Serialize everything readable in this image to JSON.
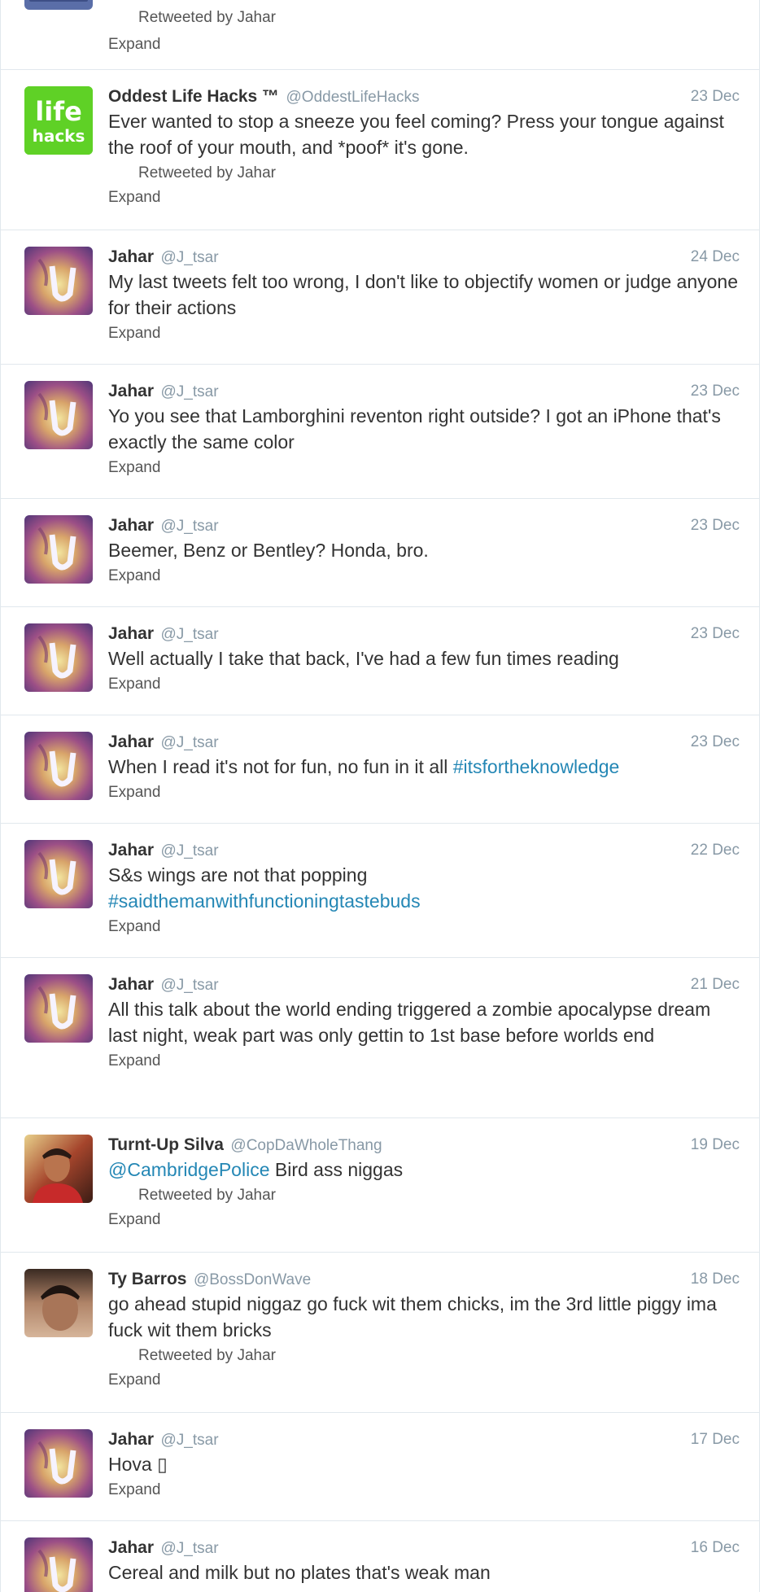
{
  "colors": {
    "link": "#2487b5",
    "meta": "#8899a6",
    "border": "#e1e8ed"
  },
  "top_partial": {
    "retweeted_by": "Retweeted by Jahar",
    "expand": "Expand"
  },
  "tweets": [
    {
      "avatar": "lifehacks-logo",
      "name": "Oddest Life Hacks ™",
      "handle": "@OddestLifeHacks",
      "date": "23 Dec",
      "text": "Ever wanted to stop a sneeze you feel coming? Press your tongue against the roof of your mouth, and *poof* it's gone.",
      "retweeted_by": "Retweeted by Jahar",
      "expand": "Expand"
    },
    {
      "avatar": "jahar-avatar",
      "name": "Jahar",
      "handle": "@J_tsar",
      "date": "24 Dec",
      "text": "My last tweets felt too wrong, I don't like to objectify women or judge anyone  for their actions",
      "expand": "Expand"
    },
    {
      "avatar": "jahar-avatar",
      "name": "Jahar",
      "handle": "@J_tsar",
      "date": "23 Dec",
      "text": "Yo you see that Lamborghini reventon right outside? I got an iPhone that's exactly the same color",
      "expand": "Expand"
    },
    {
      "avatar": "jahar-avatar",
      "name": "Jahar",
      "handle": "@J_tsar",
      "date": "23 Dec",
      "text": "Beemer, Benz or Bentley? Honda, bro.",
      "expand": "Expand"
    },
    {
      "avatar": "jahar-avatar",
      "name": "Jahar",
      "handle": "@J_tsar",
      "date": "23 Dec",
      "text": "Well actually I take that back, I've had a few fun times reading",
      "expand": "Expand"
    },
    {
      "avatar": "jahar-avatar",
      "name": "Jahar",
      "handle": "@J_tsar",
      "date": "23 Dec",
      "text": "When I read it's not for fun, no fun in it all ",
      "hashtag": "#itsfortheknowledge",
      "expand": "Expand"
    },
    {
      "avatar": "jahar-avatar",
      "name": "Jahar",
      "handle": "@J_tsar",
      "date": "22 Dec",
      "text": "S&s wings are not that popping",
      "hashtag_line": "#saidthemanwithfunctioningtastebuds",
      "expand": "Expand"
    },
    {
      "avatar": "jahar-avatar",
      "name": "Jahar",
      "handle": "@J_tsar",
      "date": "21 Dec",
      "text": "All this talk about the world ending triggered a zombie apocalypse dream last night, weak part was only gettin to 1st base before worlds end",
      "expand": "Expand"
    },
    {
      "avatar": "silva-avatar",
      "name": "Turnt-Up Silva",
      "handle": "@CopDaWholeThang",
      "date": "19 Dec",
      "mention": "@CambridgePolice",
      "text": " Bird ass niggas",
      "retweeted_by": "Retweeted by Jahar",
      "expand": "Expand"
    },
    {
      "avatar": "barros-avatar",
      "name": "Ty Barros",
      "handle": "@BossDonWave",
      "date": "18 Dec",
      "text": "go ahead stupid niggaz go fuck wit them chicks, im the 3rd little piggy ima fuck wit them bricks",
      "retweeted_by": "Retweeted by Jahar",
      "expand": "Expand"
    },
    {
      "avatar": "jahar-avatar",
      "name": "Jahar",
      "handle": "@J_tsar",
      "date": "17 Dec",
      "text": "Hova ▯",
      "expand": "Expand"
    },
    {
      "avatar": "jahar-avatar",
      "name": "Jahar",
      "handle": "@J_tsar",
      "date": "16 Dec",
      "text": "Cereal and milk but no plates that's weak man"
    }
  ]
}
